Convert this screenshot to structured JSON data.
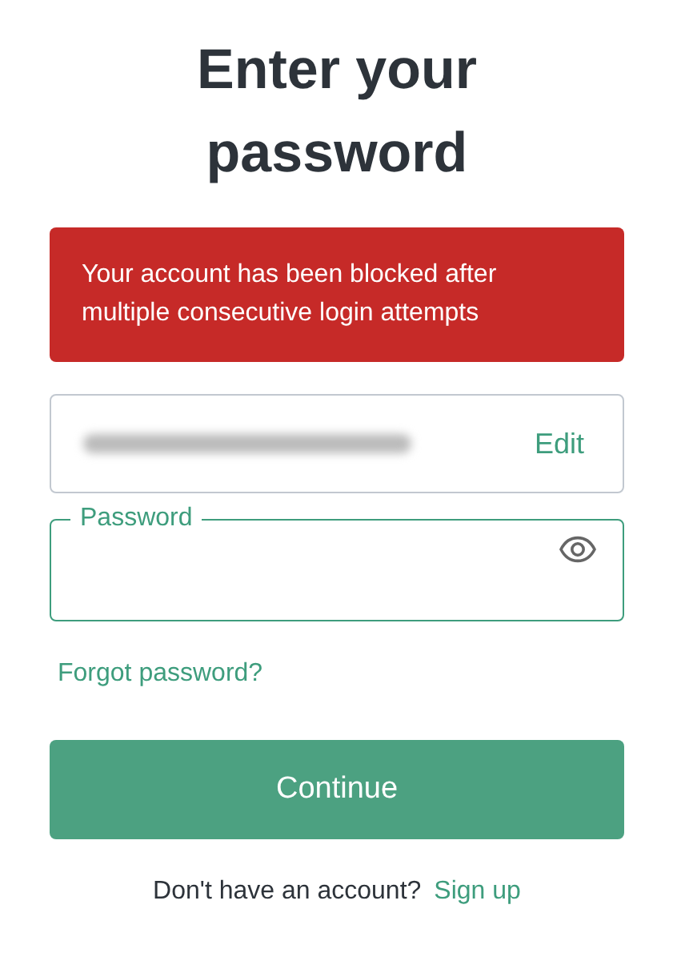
{
  "title": "Enter your password",
  "alert": {
    "message": "Your account has been blocked after multiple consecutive login attempts"
  },
  "email_field": {
    "redacted": true,
    "action": "Edit"
  },
  "password_field": {
    "label": "Password",
    "focused": true
  },
  "forgot_link": "Forgot password?",
  "continue_button": "Continue",
  "footer": {
    "text": "Don't have an account?",
    "link": "Sign up"
  }
}
